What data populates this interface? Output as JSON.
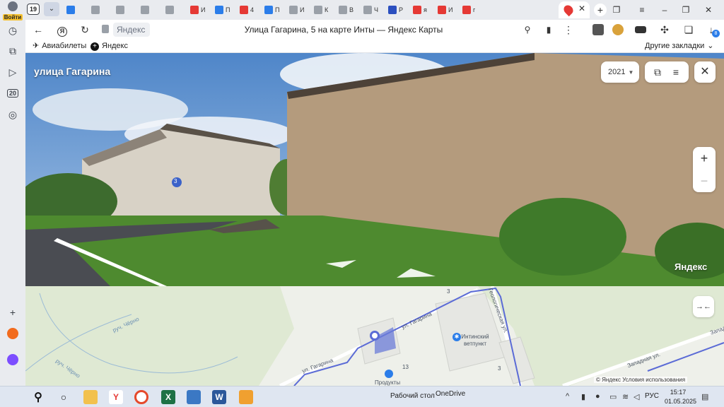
{
  "sidebar": {
    "profile_label": "Войти",
    "badge_20": "20"
  },
  "tabs": {
    "counter": "19",
    "items": [
      {
        "title": "",
        "color": "#2b7de9"
      },
      {
        "title": "",
        "color": "#9aa0a8"
      },
      {
        "title": "",
        "color": "#9aa0a8"
      },
      {
        "title": "",
        "color": "#9aa0a8"
      },
      {
        "title": "",
        "color": "#9aa0a8"
      },
      {
        "title": "И",
        "color": "#e53935"
      },
      {
        "title": "П",
        "color": "#2b7de9"
      },
      {
        "title": "4",
        "color": "#e53935"
      },
      {
        "title": "П",
        "color": "#2b7de9"
      },
      {
        "title": "И",
        "color": "#9aa0a8"
      },
      {
        "title": "К",
        "color": "#9aa0a8"
      },
      {
        "title": "В",
        "color": "#9aa0a8"
      },
      {
        "title": "Ч",
        "color": "#9aa0a8"
      },
      {
        "title": "Р",
        "color": "#2b4fbf"
      },
      {
        "title": "я",
        "color": "#e53935"
      },
      {
        "title": "И",
        "color": "#e53935"
      },
      {
        "title": "г",
        "color": "#e53935"
      }
    ],
    "new_tab": "+"
  },
  "addressbar": {
    "site": "Яндекс",
    "title": "Улица Гагарина, 5 на карте Инты — Яндекс Карты",
    "download_badge": "8"
  },
  "bookmarks": {
    "items": [
      "Авиабилеты",
      "Яндекс"
    ],
    "other": "Другие закладки"
  },
  "panorama": {
    "street": "улица Гагарина",
    "year": "2021",
    "house_number": "3",
    "logo": "Яндекс"
  },
  "map": {
    "labels": {
      "gagarina_top": "ул. Гагарина",
      "gagarina_bottom": "ул. Гагарина",
      "geology": "Геологическая ул.",
      "zapadnaya": "Западная ул.",
      "zapadnaya_edge": "Запад",
      "cherny1": "руч. Чёрно",
      "cherny2": "руч. Чёрно",
      "vet": "Интинский ветпункт",
      "products": "Продукты",
      "n3a": "3",
      "n3b": "3",
      "n13": "13"
    },
    "attribution": "© Яндекс   Условия использования",
    "route_color": "#5b6bd6"
  },
  "taskbar": {
    "desktop": "Рабочий стол",
    "onedrive": "OneDrive",
    "lang": "РУС",
    "time": "15:17",
    "date": "01.05.2025"
  }
}
